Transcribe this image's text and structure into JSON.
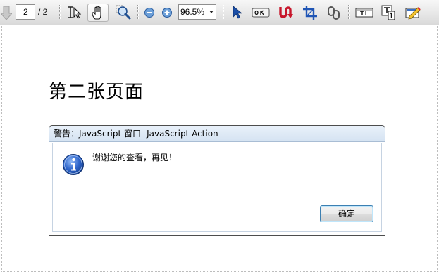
{
  "toolbar": {
    "current_page": "2",
    "total_pages": "/ 2",
    "zoom": "96.5%",
    "icons": [
      "page-down-arrow-icon",
      "select-text-icon",
      "hand-icon",
      "zoom-tool-icon",
      "zoom-out-icon",
      "zoom-in-icon",
      "select-object-icon",
      "button-field-icon",
      "link-tool-icon",
      "crop-icon",
      "attach-link-icon",
      "text-field-icon",
      "touchup-text-icon",
      "edit-pencil-icon"
    ]
  },
  "page": {
    "heading": "第二张页面"
  },
  "dialog": {
    "title": "警告：JavaScript 窗口 -JavaScript Action",
    "message": "谢谢您的查看，再见！",
    "ok_label": "确定",
    "icon": "info-icon"
  },
  "colors": {
    "toolbar_bg": "#e7e7e7",
    "dialog_title_bg": "#d5e3f2",
    "info_icon_blue": "#1d4fb3",
    "button_border": "#3c7fb1"
  }
}
